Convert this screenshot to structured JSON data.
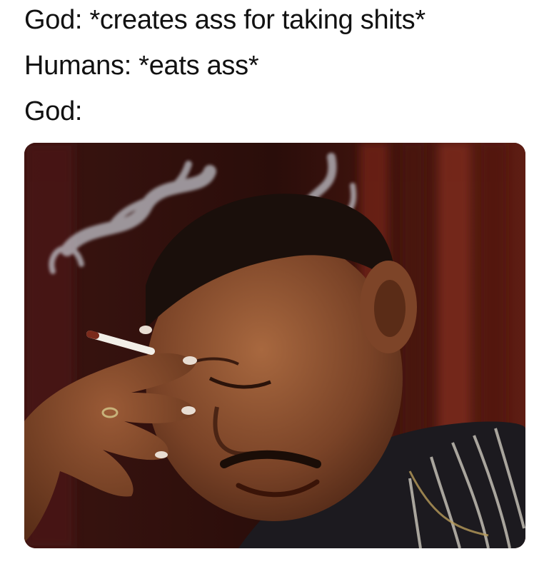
{
  "caption": {
    "line1": "God: *creates ass for taking shits*",
    "line2": "Humans: *eats ass*",
    "line3": "God:"
  },
  "photo": {
    "icon": "crying-man-smoking-photo",
    "colors": {
      "background": "#3a1410",
      "curtain": "#6e2418",
      "skin": "#8a5236",
      "shirt": "#1c1a1f",
      "smoke": "#c9cdd6"
    }
  }
}
